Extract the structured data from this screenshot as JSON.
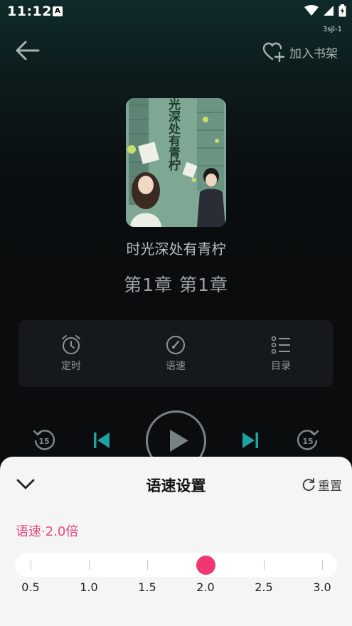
{
  "status_bar": {
    "time": "11:12",
    "notification_icon": "A",
    "build_tag": "3sjl-1"
  },
  "header": {
    "back_icon": "arrow-left-icon",
    "add_to_shelf_label": "加入书架"
  },
  "book": {
    "cover_title_art": "光深处有青柠",
    "title": "时光深处有青柠",
    "chapter": "第1章  第1章"
  },
  "controls": {
    "timer_label": "定时",
    "speed_label": "语速",
    "toc_label": "目录"
  },
  "playback": {
    "rewind_seconds": "15",
    "forward_seconds": "15"
  },
  "speed_sheet": {
    "title": "语速设置",
    "reset_label": "重置",
    "current_speed_text": "语速·2.0倍",
    "current_speed": 2.0,
    "speed_options": [
      "0.5",
      "1.0",
      "1.5",
      "2.0",
      "2.5",
      "3.0"
    ],
    "accent_color": "#ef3770"
  }
}
